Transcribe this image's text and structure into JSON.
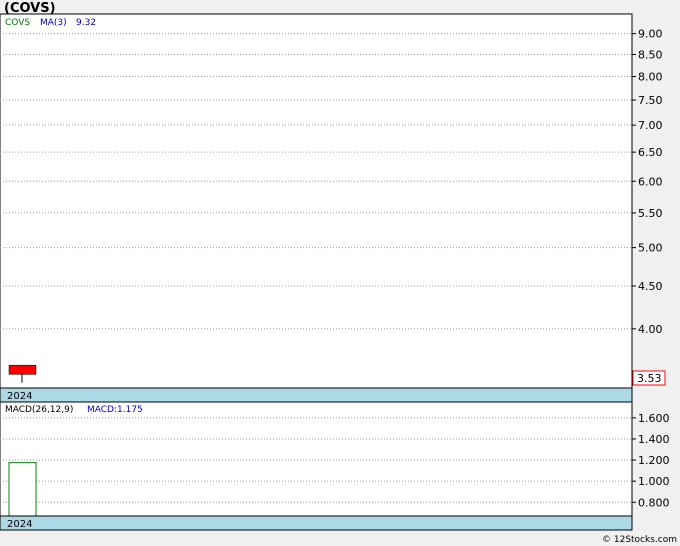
{
  "title": "(COVS)",
  "copyright": "© 12Stocks.com",
  "colors": {
    "background": "#f0f0f0",
    "plot_bg": "#ffffff",
    "grid": "#9a9a9a",
    "band": "#add8e6",
    "candle": "#ff0000",
    "ticker_label": "#008000",
    "ma_label": "#0000cc",
    "macd_bar": "#008000"
  },
  "chart_data": [
    {
      "type": "candlestick",
      "legend": {
        "ticker": "COVS",
        "ma_label": "MA(3)",
        "ma_value": "9.32"
      },
      "x_label": "2024",
      "y_ticks": [
        "9.00",
        "8.50",
        "8.00",
        "7.50",
        "7.00",
        "6.50",
        "6.00",
        "5.50",
        "5.00",
        "4.50",
        "4.00"
      ],
      "ylim": [
        3.4,
        9.5
      ],
      "y_scale": "log",
      "grid": true,
      "candles": [
        {
          "open": 3.62,
          "close": 3.53,
          "high": 3.62,
          "low": 3.45
        }
      ],
      "last_price": "3.53"
    },
    {
      "type": "bar",
      "legend": {
        "label": "MACD(26,12,9)",
        "value_label": "MACD:1.175"
      },
      "x_label": "2024",
      "y_ticks": [
        "1.600",
        "1.400",
        "1.200",
        "1.000",
        "0.800"
      ],
      "ylim": [
        0.67,
        1.75
      ],
      "grid": true,
      "values": [
        1.175
      ]
    }
  ]
}
